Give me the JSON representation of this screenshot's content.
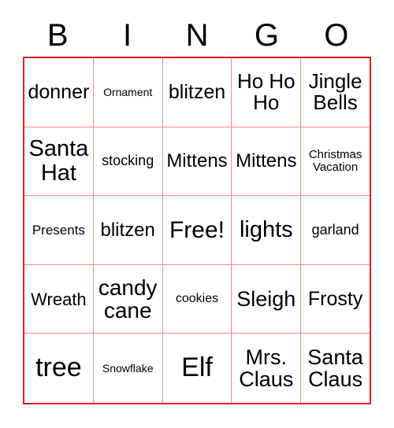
{
  "card": {
    "header": {
      "letters": [
        "B",
        "I",
        "N",
        "G",
        "O"
      ]
    },
    "grid": {
      "rows": [
        [
          {
            "text": "donner",
            "size": 25
          },
          {
            "text": "Ornament",
            "size": 14
          },
          {
            "text": "blitzen",
            "size": 25
          },
          {
            "text": "Ho Ho Ho",
            "size": 26
          },
          {
            "text": "Jingle Bells",
            "size": 26
          }
        ],
        [
          {
            "text": "Santa Hat",
            "size": 29
          },
          {
            "text": "stocking",
            "size": 18
          },
          {
            "text": "Mittens",
            "size": 24
          },
          {
            "text": "Mittens",
            "size": 24
          },
          {
            "text": "Christmas Vacation",
            "size": 15
          }
        ],
        [
          {
            "text": "Presents",
            "size": 17
          },
          {
            "text": "blitzen",
            "size": 24
          },
          {
            "text": "Free!",
            "size": 30
          },
          {
            "text": "lights",
            "size": 29
          },
          {
            "text": "garland",
            "size": 18
          }
        ],
        [
          {
            "text": "Wreath",
            "size": 22
          },
          {
            "text": "candy cane",
            "size": 28
          },
          {
            "text": "cookies",
            "size": 16
          },
          {
            "text": "Sleigh",
            "size": 27
          },
          {
            "text": "Frosty",
            "size": 25
          }
        ],
        [
          {
            "text": "tree",
            "size": 34
          },
          {
            "text": "Snowflake",
            "size": 14
          },
          {
            "text": "Elf",
            "size": 34
          },
          {
            "text": "Mrs. Claus",
            "size": 27
          },
          {
            "text": "Santa Claus",
            "size": 27
          }
        ]
      ]
    },
    "colors": {
      "outer_border": "#e31f1f",
      "inner_line": "#fa8585",
      "text": "#000000",
      "background": "#ffffff"
    }
  }
}
